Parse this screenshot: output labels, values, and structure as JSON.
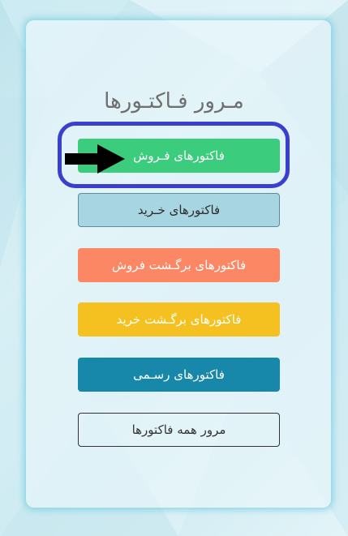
{
  "page": {
    "title": "مـرور فـاکتـورها"
  },
  "buttons": {
    "sales": "فاکتورهای فـروش",
    "purchase": "فاکتورهای خـرید",
    "return_sales": "فاکتورهای برگـشت فروش",
    "return_purchase": "فاکتورهای برگـشت خرید",
    "official": "فاکتورهای رسـمی",
    "all": "مرور همه فاکتورها"
  },
  "annotation": {
    "highlight_color": "#3a3fce",
    "arrow_color": "#000000",
    "arrow_icon": "arrow-right-icon"
  },
  "colors": {
    "sales": "#3ccc7d",
    "purchase": "#a7d5e1",
    "return_sales": "#fb8764",
    "return_purchase": "#f4c121",
    "official": "#1788a9"
  }
}
